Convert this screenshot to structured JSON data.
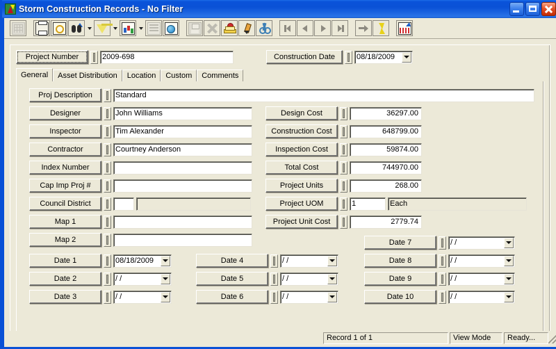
{
  "window": {
    "title": "Storm Construction Records - No Filter",
    "icon": "storm-app-icon",
    "minimize_label": "Minimize",
    "maximize_label": "Maximize",
    "close_label": "Close"
  },
  "toolbar": {
    "items": [
      {
        "name": "grid-view-icon",
        "enabled": false
      },
      {
        "name": "print-icon",
        "enabled": true
      },
      {
        "name": "print-preview-icon",
        "enabled": true
      },
      {
        "name": "find-icon",
        "enabled": true,
        "dropdown": true
      },
      {
        "name": "filter-icon",
        "enabled": true,
        "dropdown": true
      },
      {
        "name": "report-icon",
        "enabled": true,
        "dropdown": true
      },
      {
        "name": "properties-icon",
        "enabled": false
      },
      {
        "name": "web-export-icon",
        "enabled": true
      },
      {
        "name": "save-icon",
        "enabled": false
      },
      {
        "name": "delete-icon",
        "enabled": false
      },
      {
        "name": "copy-record-icon",
        "enabled": true
      },
      {
        "name": "edit-icon",
        "enabled": true
      },
      {
        "name": "cut-icon",
        "enabled": true
      },
      {
        "name": "first-record-icon",
        "enabled": false
      },
      {
        "name": "previous-record-icon",
        "enabled": false
      },
      {
        "name": "next-record-icon",
        "enabled": false
      },
      {
        "name": "last-record-icon",
        "enabled": false
      },
      {
        "name": "goto-record-icon",
        "enabled": false
      },
      {
        "name": "quick-action-icon",
        "enabled": true
      },
      {
        "name": "export-icon",
        "enabled": true
      }
    ]
  },
  "header": {
    "project_number_label": "Project Number",
    "project_number_value": "2009-698",
    "construction_date_label": "Construction Date",
    "construction_date_value": "08/18/2009"
  },
  "tabs": [
    {
      "label": "General",
      "active": true
    },
    {
      "label": "Asset Distribution",
      "active": false
    },
    {
      "label": "Location",
      "active": false
    },
    {
      "label": "Custom",
      "active": false
    },
    {
      "label": "Comments",
      "active": false
    }
  ],
  "general": {
    "description": {
      "label": "Proj Description",
      "value": "Standard"
    },
    "left_fields": [
      {
        "label": "Designer",
        "value": "John Williams"
      },
      {
        "label": "Inspector",
        "value": "Tim Alexander"
      },
      {
        "label": "Contractor",
        "value": "Courtney Anderson"
      },
      {
        "label": "Index Number",
        "value": ""
      },
      {
        "label": "Cap Imp Proj #",
        "value": ""
      }
    ],
    "council_district": {
      "label": "Council District",
      "code": "",
      "description": ""
    },
    "maps": [
      {
        "label": "Map 1",
        "value": ""
      },
      {
        "label": "Map 2",
        "value": ""
      }
    ],
    "cost_fields": [
      {
        "label": "Design Cost",
        "value": "36297.00"
      },
      {
        "label": "Construction Cost",
        "value": "648799.00"
      },
      {
        "label": "Inspection Cost",
        "value": "59874.00"
      },
      {
        "label": "Total Cost",
        "value": "744970.00"
      },
      {
        "label": "Project Units",
        "value": "268.00"
      }
    ],
    "project_uom": {
      "label": "Project UOM",
      "code": "1",
      "description": "Each"
    },
    "project_unit_cost": {
      "label": "Project Unit Cost",
      "value": "2779.74"
    },
    "dates_col1": [
      {
        "label": "Date 1",
        "value": "08/18/2009"
      },
      {
        "label": "Date 2",
        "value": "  /  /"
      },
      {
        "label": "Date 3",
        "value": "  /  /"
      }
    ],
    "dates_col2": [
      {
        "label": "Date 4",
        "value": "  /  /"
      },
      {
        "label": "Date 5",
        "value": "  /  /"
      },
      {
        "label": "Date 6",
        "value": "  /  /"
      }
    ],
    "dates_col3": [
      {
        "label": "Date 7",
        "value": "  /  /"
      },
      {
        "label": "Date 8",
        "value": "  /  /"
      },
      {
        "label": "Date 9",
        "value": "  /  /"
      },
      {
        "label": "Date 10",
        "value": "  /  /"
      }
    ]
  },
  "statusbar": {
    "record": "Record 1 of 1",
    "mode": "View Mode",
    "state": "Ready..."
  },
  "colors": {
    "titlebar_blue": "#0a51d6",
    "window_face": "#ece9d8",
    "field_white": "#ffffff",
    "border_shadow": "#aca899"
  }
}
